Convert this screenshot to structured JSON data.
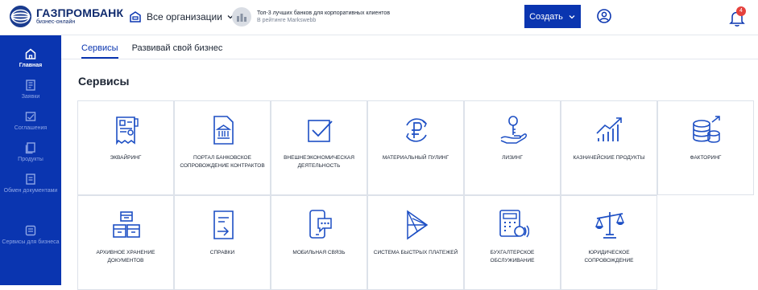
{
  "header": {
    "logo_name": "ГАЗПРОМБАНК",
    "logo_sub": "бизнес-онлайн",
    "org_label": "Все организации",
    "promo_line1": "Топ-3 лучших банков для корпоративных клиентов",
    "promo_line2": "В рейтинге Markswebb",
    "create_label": "Создать",
    "notification_count": "4"
  },
  "sidebar": {
    "items": [
      {
        "label": "Главная",
        "icon": "home-icon"
      },
      {
        "label": "Заявки",
        "icon": "requests-icon"
      },
      {
        "label": "Соглашения",
        "icon": "agreements-icon"
      },
      {
        "label": "Продукты",
        "icon": "products-icon"
      },
      {
        "label": "Обмен документами",
        "icon": "documents-exchange-icon"
      },
      {
        "label": "Сервисы для бизнеса",
        "icon": "business-services-icon"
      }
    ]
  },
  "tabs": [
    {
      "label": "Сервисы"
    },
    {
      "label": "Развивай свой бизнес"
    }
  ],
  "page_title": "Сервисы",
  "services": [
    {
      "label": "ЭКВАЙРИНГ",
      "icon": "terminal-icon"
    },
    {
      "label": "ПОРТАЛ БАНКОВСКОЕ СОПРОВОЖДЕНИЕ КОНТРАКТОВ",
      "icon": "bank-document-icon"
    },
    {
      "label": "ВНЕШНЕЭКОНОМИЧЕСКАЯ ДЕЯТЕЛЬНОСТЬ",
      "icon": "checkbox-icon"
    },
    {
      "label": "МАТЕРИАЛЬНЫЙ ПУЛИНГ",
      "icon": "ruble-cycle-icon"
    },
    {
      "label": "ЛИЗИНГ",
      "icon": "key-hand-icon"
    },
    {
      "label": "КАЗНАЧЕЙСКИЕ ПРОДУКТЫ",
      "icon": "growth-chart-icon"
    },
    {
      "label": "ФАКТОРИНГ",
      "icon": "coins-icon"
    },
    {
      "label": "АРХИВНОЕ ХРАНЕНИЕ ДОКУМЕНТОВ",
      "icon": "archive-boxes-icon"
    },
    {
      "label": "СПРАВКИ",
      "icon": "certificate-icon"
    },
    {
      "label": "МОБИЛЬНАЯ СВЯЗЬ",
      "icon": "mobile-chat-icon"
    },
    {
      "label": "СИСТЕМА БЫСТРЫХ ПЛАТЕЖЕЙ",
      "icon": "sbp-icon"
    },
    {
      "label": "БУХГАЛТЕРСКОЕ ОБСЛУЖИВАНИЕ",
      "icon": "calculator-icon"
    },
    {
      "label": "ЮРИДИЧЕСКОЕ СОПРОВОЖДЕНИЕ",
      "icon": "scales-icon"
    }
  ],
  "colors": {
    "brand_blue": "#0a35b0",
    "icon_blue": "#1d4fc4",
    "badge_red": "#e5413d"
  }
}
